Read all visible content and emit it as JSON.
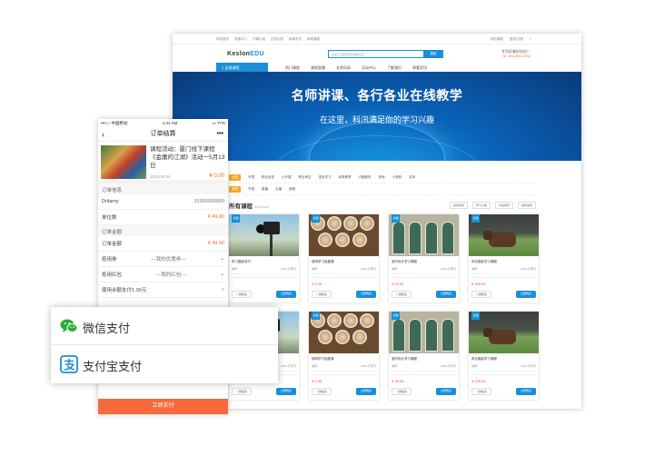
{
  "desktop": {
    "topbar_links": [
      "网站首页",
      "资源中心",
      "兴趣小组",
      "在线问答",
      "新闻资讯",
      "网络课程"
    ],
    "topbar_right": [
      "我的课程",
      "登录/注册"
    ],
    "logo_main": "Keslon",
    "logo_accent": "EDU",
    "search_placeholder": "请输入您要搜索的课程名称",
    "search_button": "搜索",
    "hotline_label": "专为好者好存在！",
    "hotline_number": "400-000-0202",
    "category_button": "全部课程",
    "nav_items": [
      "热门课程",
      "课程直播",
      "名师风采",
      "活动中心",
      "了解我们",
      "原看资讯"
    ],
    "banner_title": "名师讲课、各行各业在线教学",
    "banner_subtitle": "在这里，科汛满足你的学习兴趣",
    "filter_row1_tag": "分类",
    "filter_row1": [
      "不限",
      "职业培训",
      "公开课",
      "职业考证",
      "语言学习",
      "体育教育",
      "兴趣爱好",
      "其他",
      "小语种",
      "名师"
    ],
    "filter_row2_tag": "类型",
    "filter_row2": [
      "不限",
      "直播",
      "点播",
      "面授"
    ],
    "section_title": "所有课程",
    "section_subtitle": "All Course",
    "sorts": [
      "综合排序",
      "学习人数",
      "价格排序",
      "最新发布"
    ],
    "courses": [
      {
        "badge": "点播",
        "name": "学习摄影技巧",
        "meta_left": "讲师:",
        "meta_right": "245人已学习",
        "price": "",
        "b1": "了解更多",
        "b2": "立即购买"
      },
      {
        "badge": "点播",
        "name": "咖啡学习品鉴课",
        "meta_left": "讲师:",
        "meta_right": "245人已学习",
        "price": "¥ 0.00",
        "b1": "了解更多",
        "b2": "立即购买"
      },
      {
        "badge": "点播",
        "name": "室内设计学习课程",
        "meta_left": "讲师:",
        "meta_right": "245人已学习",
        "price": "¥ 99.00",
        "b1": "了解更多",
        "b2": "立即购买"
      },
      {
        "badge": "点播",
        "name": "风光摄影学习课程",
        "meta_left": "讲师:",
        "meta_right": "245人已学习",
        "price": "¥ 199.00",
        "b1": "了解更多",
        "b2": "立即购买"
      },
      {
        "badge": "点播",
        "name": "学习摄影技巧",
        "meta_left": "讲师:",
        "meta_right": "245人已学习",
        "price": "",
        "b1": "了解更多",
        "b2": "立即购买"
      },
      {
        "badge": "点播",
        "name": "咖啡学习品鉴课",
        "meta_left": "讲师:",
        "meta_right": "245人已学习",
        "price": "¥ 0.00",
        "b1": "了解更多",
        "b2": "立即购买"
      },
      {
        "badge": "点播",
        "name": "室内设计学习课程",
        "meta_left": "讲师:",
        "meta_right": "245人已学习",
        "price": "¥ 99.00",
        "b1": "了解更多",
        "b2": "立即购买"
      },
      {
        "badge": "点播",
        "name": "风光摄影学习课程",
        "meta_left": "讲师:",
        "meta_right": "245人已学习",
        "price": "¥ 199.00",
        "b1": "了解更多",
        "b2": "立即购买"
      }
    ]
  },
  "phone": {
    "carrier": "•••○○ 中国移动",
    "time": "1:41 AM",
    "battery": "77%",
    "title": "订单结算",
    "back_icon": "chevron-left-icon",
    "more_icon": "more-dots-icon",
    "order_title": "课程活动：厦门线下课程《金庸的江湖》活动一5月13日",
    "order_date": "2018.05.24",
    "order_price": "¥ 0.00",
    "section_info": "订单信息",
    "rows_info": [
      {
        "label": "Drilamy",
        "value": "15300000000"
      },
      {
        "label": "单位数",
        "value": "¥ 49.00",
        "red": true
      }
    ],
    "section_amount": "订单金额",
    "rows_amount": [
      {
        "label": "订单金额",
        "value": "¥ 49.00",
        "red": true
      }
    ],
    "rows_discount": [
      {
        "label": "抵用券",
        "value": "—我的优惠券—"
      },
      {
        "label": "抵用红包",
        "value": "—我的红包—"
      },
      {
        "label": "使用余额支付1.00元",
        "value": ""
      }
    ],
    "pay_button": "立即支付"
  },
  "payment": {
    "options": [
      {
        "label": "微信支付",
        "icon": "wechat-pay-icon"
      },
      {
        "label": "支付宝支付",
        "icon": "alipay-icon"
      }
    ],
    "wechat_color": "#2aae36",
    "alipay_color": "#1a8fd8"
  },
  "colors": {
    "brand_blue": "#1a8fd8",
    "accent_orange": "#f76a3c",
    "price_red": "#f5413b"
  }
}
